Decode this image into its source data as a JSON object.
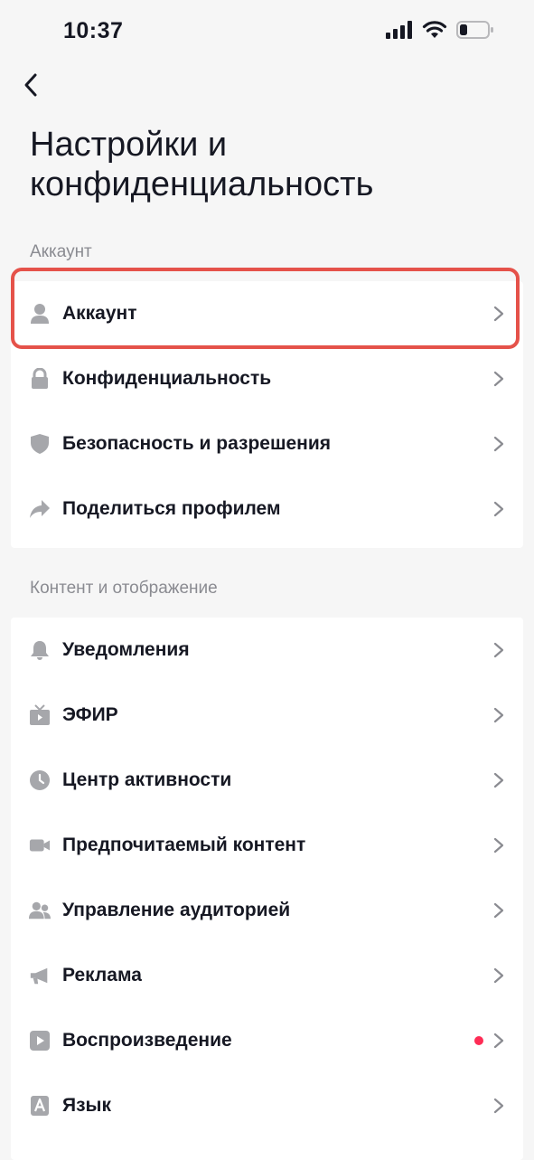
{
  "status_bar": {
    "time": "10:37"
  },
  "header": {
    "title_line1": "Настройки и",
    "title_line2": "конфиденциальность"
  },
  "sections": [
    {
      "title": "Аккаунт",
      "items": [
        {
          "label": "Аккаунт",
          "icon": "person-icon"
        },
        {
          "label": "Конфиденциальность",
          "icon": "lock-icon"
        },
        {
          "label": "Безопасность и разрешения",
          "icon": "shield-icon"
        },
        {
          "label": "Поделиться профилем",
          "icon": "share-icon"
        }
      ]
    },
    {
      "title": "Контент и отображение",
      "items": [
        {
          "label": "Уведомления",
          "icon": "bell-icon"
        },
        {
          "label": "ЭФИР",
          "icon": "tv-icon"
        },
        {
          "label": "Центр активности",
          "icon": "clock-icon"
        },
        {
          "label": "Предпочитаемый контент",
          "icon": "video-camera-icon"
        },
        {
          "label": "Управление аудиторией",
          "icon": "users-icon"
        },
        {
          "label": "Реклама",
          "icon": "megaphone-icon"
        },
        {
          "label": "Воспроизведение",
          "icon": "play-icon",
          "has_dot": true
        },
        {
          "label": "Язык",
          "icon": "language-icon"
        }
      ]
    }
  ],
  "colors": {
    "highlight": "#e5524a",
    "notification_dot": "#fe2c55",
    "icon_gray": "#a6a7ab"
  }
}
